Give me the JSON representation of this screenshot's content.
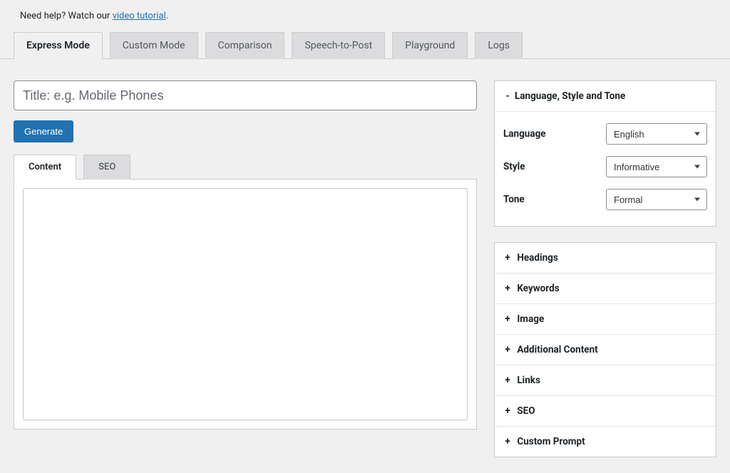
{
  "help": {
    "prefix": "Need help? Watch our ",
    "link_text": "video tutorial",
    "suffix": "."
  },
  "tabs": [
    {
      "label": "Express Mode",
      "active": true
    },
    {
      "label": "Custom Mode",
      "active": false
    },
    {
      "label": "Comparison",
      "active": false
    },
    {
      "label": "Speech-to-Post",
      "active": false
    },
    {
      "label": "Playground",
      "active": false
    },
    {
      "label": "Logs",
      "active": false
    }
  ],
  "titleInput": {
    "placeholder": "Title: e.g. Mobile Phones",
    "value": ""
  },
  "generateButton": "Generate",
  "subTabs": [
    {
      "label": "Content",
      "active": true
    },
    {
      "label": "SEO",
      "active": false
    }
  ],
  "expandedPanel": {
    "toggleSymbol": "-",
    "title": "Language, Style and Tone",
    "rows": [
      {
        "label": "Language",
        "value": "English"
      },
      {
        "label": "Style",
        "value": "Informative"
      },
      {
        "label": "Tone",
        "value": "Formal"
      }
    ]
  },
  "collapsedPanels": [
    {
      "toggleSymbol": "+",
      "title": "Headings"
    },
    {
      "toggleSymbol": "+",
      "title": "Keywords"
    },
    {
      "toggleSymbol": "+",
      "title": "Image"
    },
    {
      "toggleSymbol": "+",
      "title": "Additional Content"
    },
    {
      "toggleSymbol": "+",
      "title": "Links"
    },
    {
      "toggleSymbol": "+",
      "title": "SEO"
    },
    {
      "toggleSymbol": "+",
      "title": "Custom Prompt"
    }
  ]
}
